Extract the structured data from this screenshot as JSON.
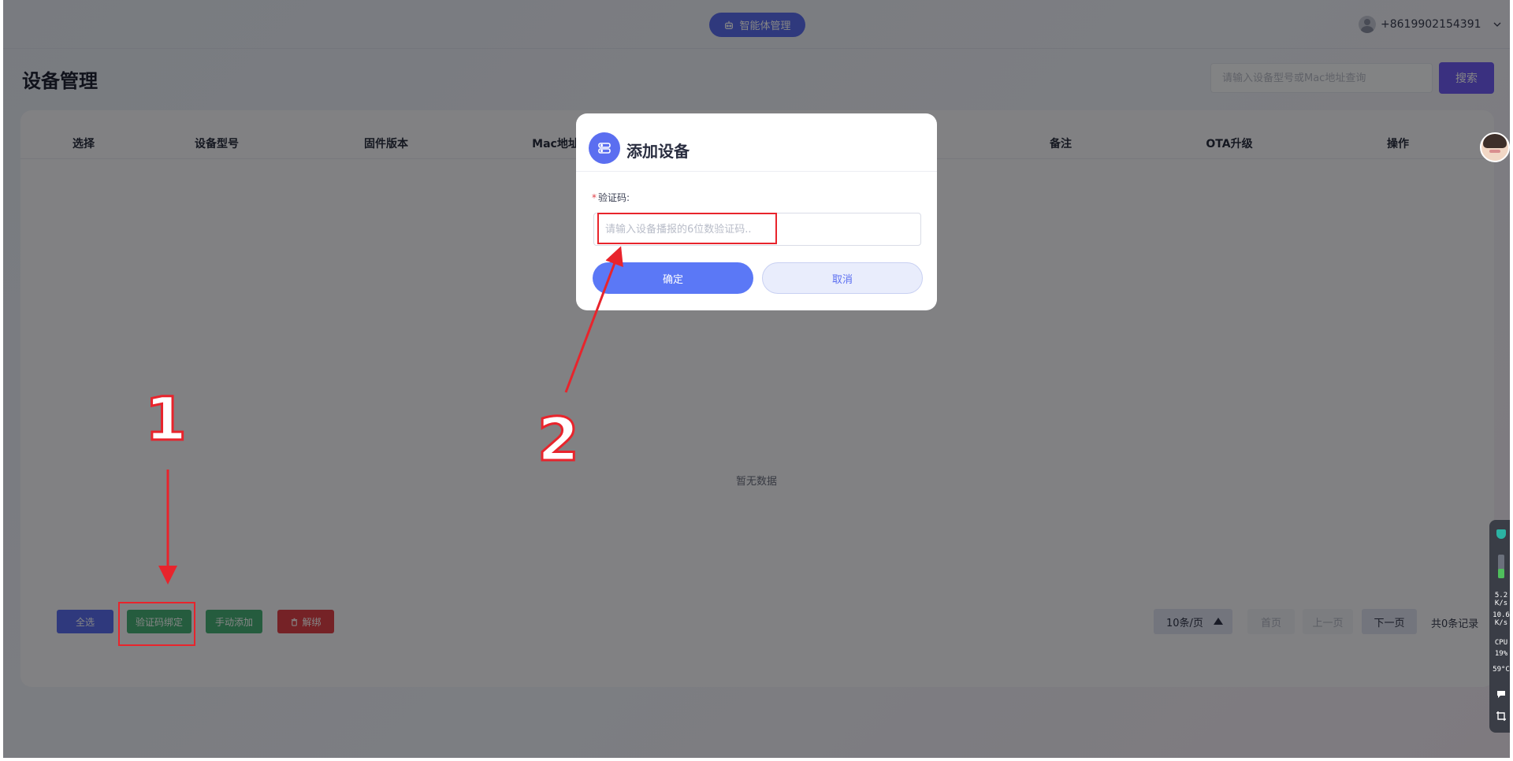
{
  "header": {
    "agent_button": "智能体管理",
    "user_phone": "+8619902154391"
  },
  "page": {
    "title": "设备管理",
    "search_placeholder": "请输入设备型号或Mac地址查询",
    "search_button": "搜索"
  },
  "table": {
    "columns": [
      "选择",
      "设备型号",
      "固件版本",
      "Mac地址",
      "备注",
      "OTA升级",
      "操作"
    ],
    "empty_text": "暂无数据"
  },
  "bulk_actions": {
    "select_all": "全选",
    "verify_bind": "验证码绑定",
    "manual_add": "手动添加",
    "unbind": "解绑"
  },
  "pagination": {
    "page_size": "10条/页",
    "first": "首页",
    "prev": "上一页",
    "next": "下一页",
    "total": "共0条记录"
  },
  "modal": {
    "title": "添加设备",
    "field_label": "验证码:",
    "field_placeholder": "请输入设备播报的6位数验证码..",
    "ok": "确定",
    "cancel": "取消"
  },
  "annotations": {
    "step1": "1",
    "step2": "2"
  },
  "monitor": {
    "net_up": "5.2",
    "net_up_unit": "K/s",
    "net_down": "10.6",
    "net_down_unit": "K/s",
    "cpu_label": "CPU",
    "cpu": "19%",
    "temp": "59°C"
  },
  "colors": {
    "primary": "#5b6ef0",
    "search": "#6f5cf6",
    "success": "#48b178",
    "danger": "#e0424a",
    "annotation": "#e8242c"
  }
}
